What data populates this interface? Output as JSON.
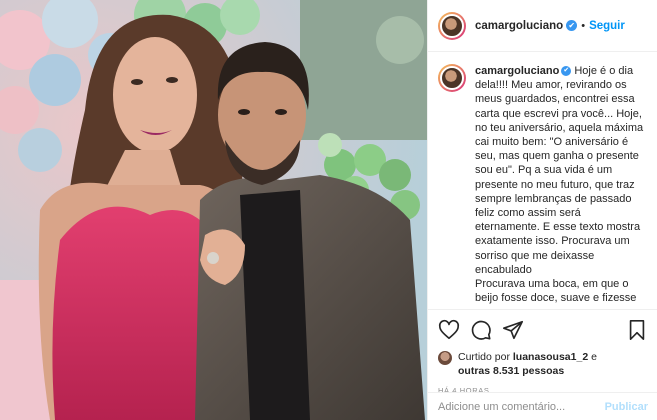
{
  "post": {
    "username": "camargoluciano",
    "follow_label": "Seguir",
    "separator": "•",
    "verified_icon": "✔",
    "caption_username": "camargoluciano",
    "caption_text": "Hoje é o dia dela!!!! Meu amor, revirando os meus guardados, encontrei essa carta que escrevi pra você... Hoje, no teu aniversário, aquela máxima cai muito bem: \"O aniversário é seu, mas quem ganha o presente sou eu\". Pq a sua vida é um presente no meu futuro, que traz sempre lembranças de passado feliz como assim será eternamente. E esse texto mostra exatamente isso. Procurava um sorriso que me deixasse encabulado\nProcurava uma boca, em que o beijo fosse doce, suave e fizesse eu querer mais...\nProcurava um abraço que me prendesse feito laço e me fizesse não quisesse mais sair... um corpo para o",
    "likes_prefix": "Curtido por",
    "liked_by": "luanasousa1_2",
    "likes_mid": "e",
    "likes_others": "outras 8.531 pessoas",
    "time": "HÁ 4 HORAS",
    "comment_placeholder": "Adicione um comentário...",
    "publish_label": "Publicar"
  },
  "icons": [
    "heart-icon",
    "comment-icon",
    "share-icon",
    "bookmark-icon",
    "verified-badge-icon"
  ],
  "colors": {
    "accent": "#0095f6",
    "verified": "#3897f0",
    "publish_disabled": "#b2dffc",
    "muted": "#8e8e8e"
  }
}
